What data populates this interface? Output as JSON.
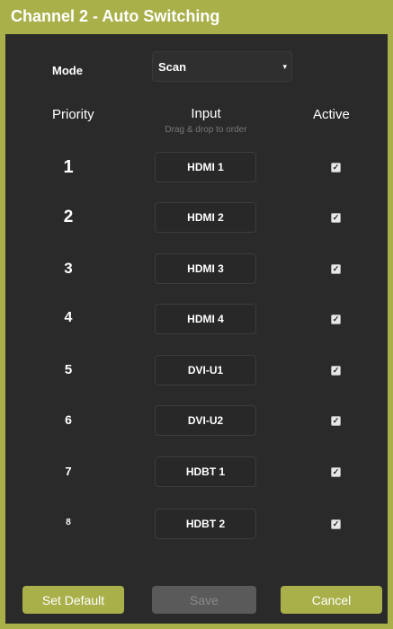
{
  "window": {
    "title": "Channel 2 - Auto Switching"
  },
  "mode": {
    "label": "Mode",
    "value": "Scan",
    "caret": "▾"
  },
  "table": {
    "headers": {
      "priority": "Priority",
      "input": "Input",
      "input_hint": "Drag & drop to order",
      "active": "Active"
    },
    "check_glyph": "✓",
    "rows": [
      {
        "priority": "1",
        "input": "HDMI 1",
        "active": true
      },
      {
        "priority": "2",
        "input": "HDMI 2",
        "active": true
      },
      {
        "priority": "3",
        "input": "HDMI 3",
        "active": true
      },
      {
        "priority": "4",
        "input": "HDMI 4",
        "active": true
      },
      {
        "priority": "5",
        "input": "DVI-U1",
        "active": true
      },
      {
        "priority": "6",
        "input": "DVI-U2",
        "active": true
      },
      {
        "priority": "7",
        "input": "HDBT 1",
        "active": true
      },
      {
        "priority": "8",
        "input": "HDBT 2",
        "active": true
      }
    ]
  },
  "buttons": {
    "set_default": "Set Default",
    "save": "Save",
    "cancel": "Cancel"
  },
  "colors": {
    "accent": "#a9b04a",
    "panel_bg": "#2a2a2a",
    "disabled_button": "#5a5a5a"
  }
}
